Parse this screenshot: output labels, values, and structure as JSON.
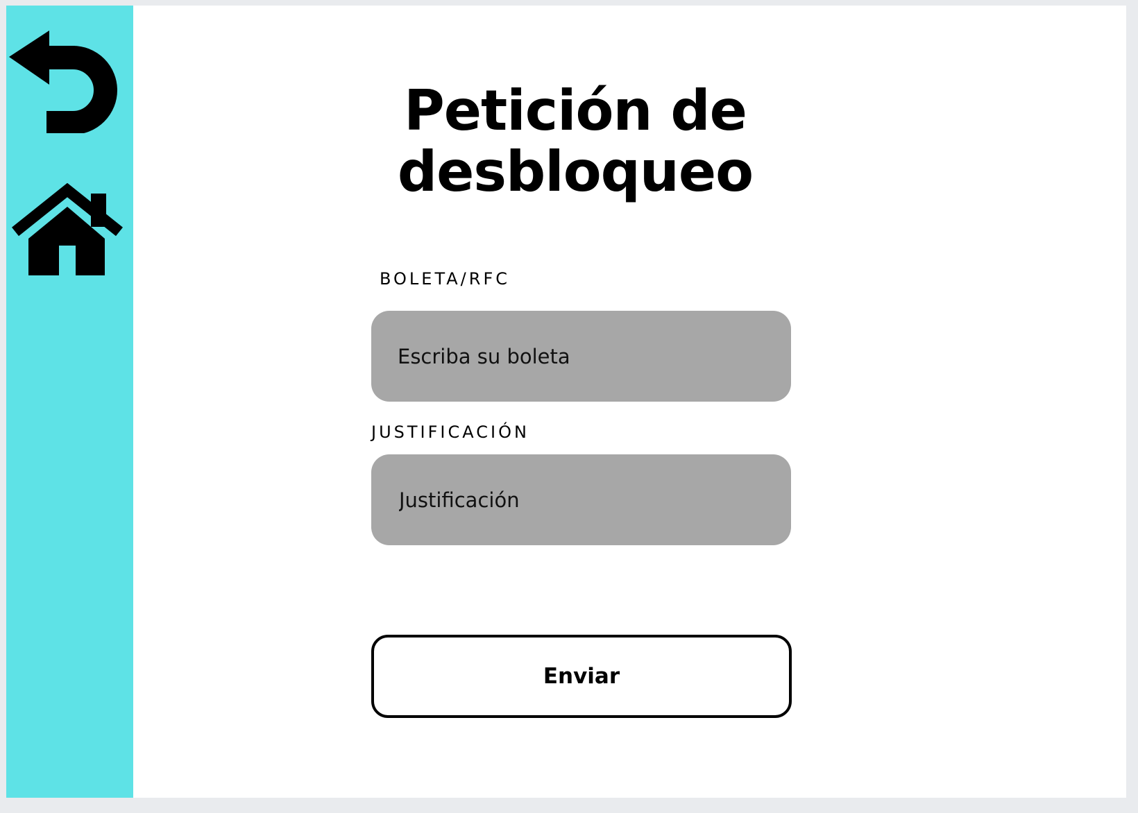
{
  "sidebar": {
    "background": "#5ee2e6",
    "back": {
      "icon": "back-arrow-icon"
    },
    "home": {
      "icon": "home-icon"
    }
  },
  "page": {
    "title": "Petición de desbloqueo"
  },
  "form": {
    "boleta": {
      "label": "BOLETA/RFC",
      "placeholder": "Escriba su boleta",
      "value": ""
    },
    "justificacion": {
      "label": "JUSTIFICACIÓN",
      "placeholder": "Justificación",
      "value": ""
    },
    "submit_label": "Enviar"
  },
  "colors": {
    "sidebar": "#5ee2e6",
    "field_background": "#a7a7a7",
    "text": "#000000",
    "canvas": "#ffffff"
  }
}
